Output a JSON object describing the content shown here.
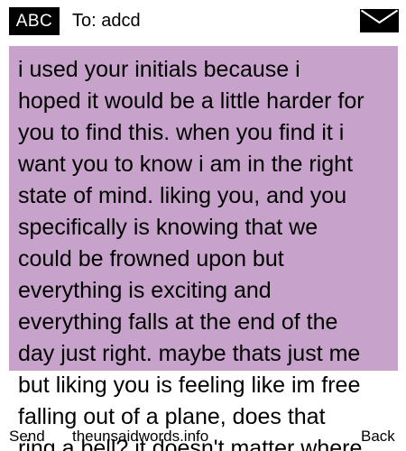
{
  "header": {
    "input_mode": "ABC",
    "recipient": "To: adcd",
    "icon": "envelope-icon"
  },
  "message": {
    "text": "i used your initials because i\nhoped it would be a little harder for\nyou to find this. when you find it i\nwant you to know i am in the right\nstate of mind. liking you, and you\nspecifically is knowing that we\ncould be frowned upon but\neverything is exciting and\neverything falls at the end of the\nday just right. maybe thats just me\nbut liking you is feeling like im free\nfalling out of a plane, does that\nring a bell? it doesn't matter where"
  },
  "softkeys": {
    "left": "Send",
    "center": "theunsaidwords.info",
    "right": "Back"
  },
  "colors": {
    "highlight": "#c7a2cb",
    "badge_background": "#000000",
    "badge_text": "#ffffff"
  }
}
